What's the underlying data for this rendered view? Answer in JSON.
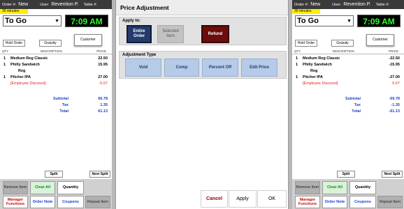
{
  "order": {
    "order_label": "Order #:",
    "order_value": "New",
    "user_label": "User:",
    "user_value": "Revention P.",
    "table_label": "Table #:",
    "time_badge": "30 minutes",
    "order_type": "To Go",
    "clock": "7:09 AM",
    "hold_order": "Hold Order",
    "gratuity": "Gratuity",
    "customer": "Customer",
    "columns": {
      "qty": "QTY",
      "description": "DESCRIPTION",
      "price": "PRICE"
    },
    "items_left": [
      {
        "qty": "1",
        "desc": "Medium Reg Classic",
        "price": "22.50"
      },
      {
        "qty": "1",
        "desc": "Philly Sandwich",
        "price": "15.95"
      },
      {
        "qty": "",
        "desc": "Reg",
        "price": ""
      },
      {
        "qty": "1",
        "desc": "Pitcher IPA",
        "price": "27.00"
      },
      {
        "qty": "",
        "desc": "[Employee Discount]",
        "price": "-5.67"
      }
    ],
    "items_right": [
      {
        "qty": "1",
        "desc": "Medium Reg Classic",
        "price": "-22.50"
      },
      {
        "qty": "1",
        "desc": "Philly Sandwich",
        "price": "-15.95"
      },
      {
        "qty": "",
        "desc": "Reg",
        "price": ""
      },
      {
        "qty": "1",
        "desc": "Pitcher IPA",
        "price": "-27.00"
      },
      {
        "qty": "",
        "desc": "[Employee Discount]",
        "price": "5.67"
      }
    ],
    "totals_left": {
      "subtotal_label": "Subtotal",
      "subtotal": "56.78",
      "tax_label": "Tax",
      "tax": "1.35",
      "total_label": "Total",
      "total": "61.13"
    },
    "totals_right": {
      "subtotal_label": "Subtotal",
      "subtotal": "-59.78",
      "tax_label": "Tax",
      "tax": "-1.35",
      "total_label": "Total",
      "total": "-61.13"
    },
    "split": "Split",
    "next_split": "Next Split",
    "remove_item": "Remove Item",
    "clear_all": "Clear All",
    "quantity": "Quantity",
    "manager_functions": "Manager Functions",
    "order_note": "Order Note",
    "coupons": "Coupons",
    "repeat_item": "Repeat Item"
  },
  "modal": {
    "title": "Price Adjustment",
    "apply_to_label": "Apply to:",
    "entire_order": "Entire Order",
    "selected_item": "Selected Item",
    "refund": "Refund",
    "adjustment_type_label": "Adjustment Type",
    "void": "Void",
    "comp": "Comp",
    "percent_off": "Percent Off",
    "edit_price": "Edit Price",
    "cancel": "Cancel",
    "apply": "Apply",
    "ok": "OK"
  }
}
